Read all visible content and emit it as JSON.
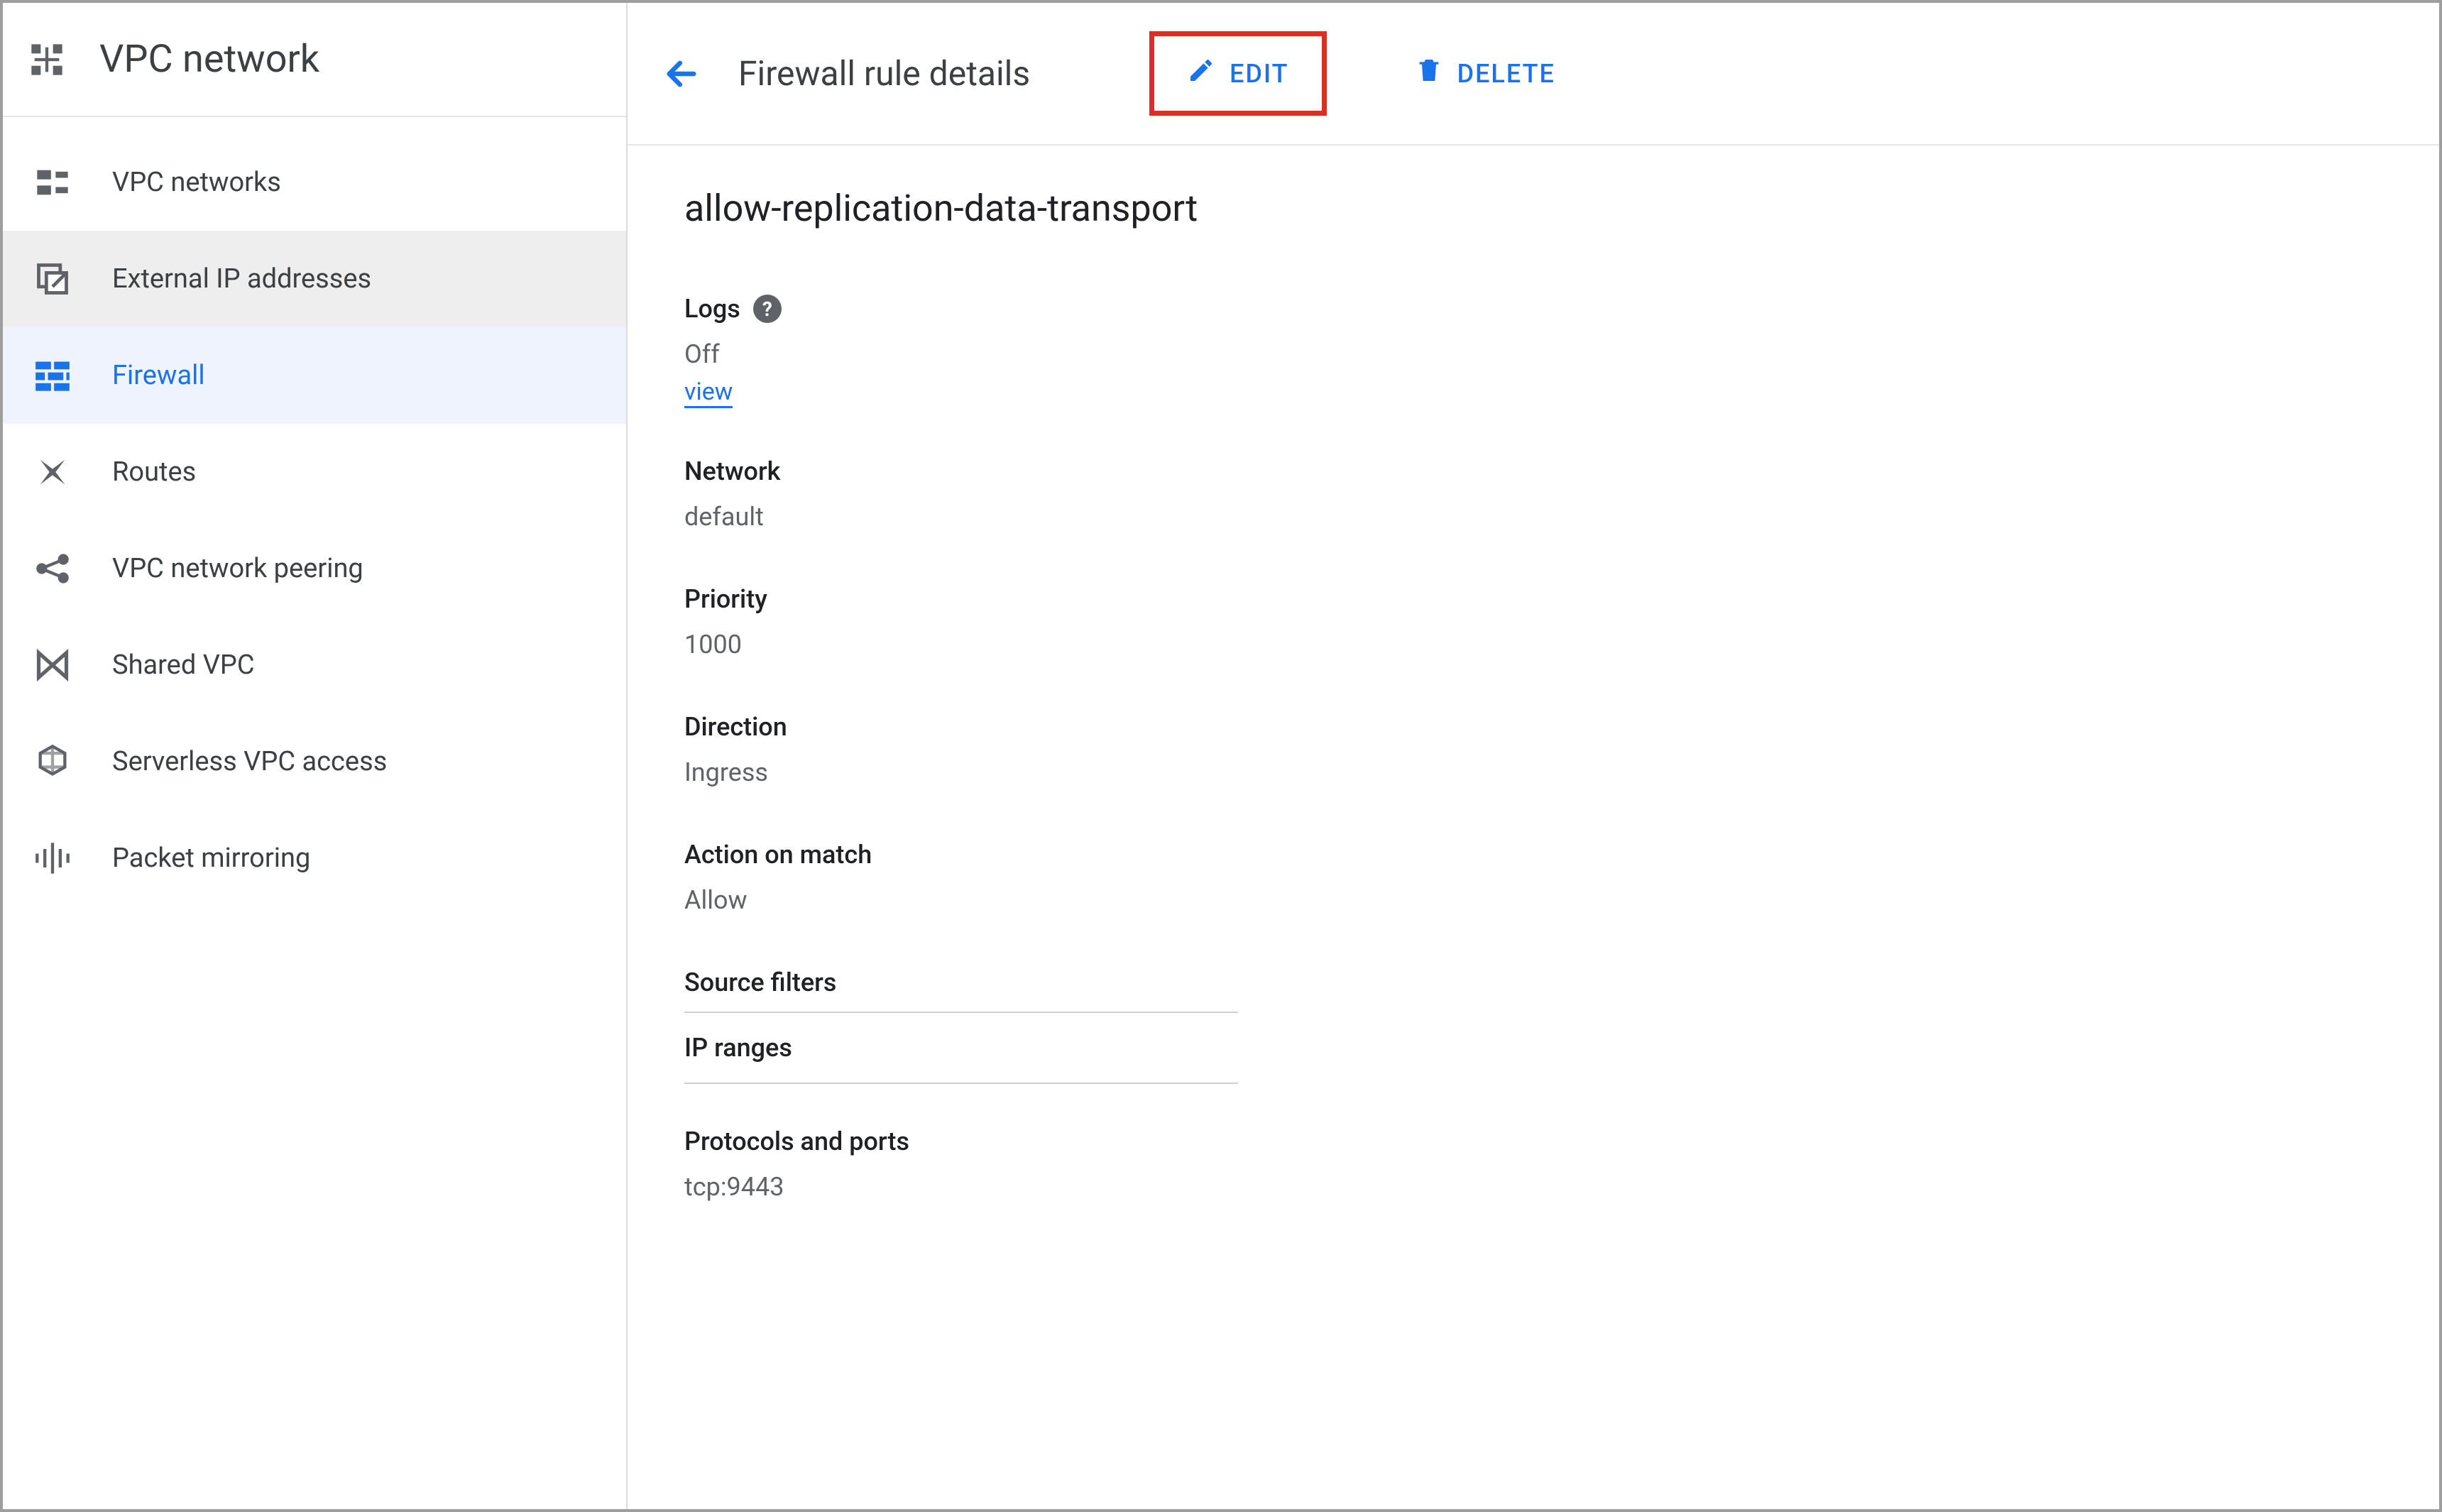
{
  "sidebar": {
    "title": "VPC network",
    "items": [
      {
        "label": "VPC networks"
      },
      {
        "label": "External IP addresses"
      },
      {
        "label": "Firewall"
      },
      {
        "label": "Routes"
      },
      {
        "label": "VPC network peering"
      },
      {
        "label": "Shared VPC"
      },
      {
        "label": "Serverless VPC access"
      },
      {
        "label": "Packet mirroring"
      }
    ]
  },
  "header": {
    "page_title": "Firewall rule details",
    "edit_label": "EDIT",
    "delete_label": "DELETE"
  },
  "rule": {
    "name": "allow-replication-data-transport",
    "logs": {
      "label": "Logs",
      "value": "Off",
      "view_link": "view"
    },
    "network": {
      "label": "Network",
      "value": "default"
    },
    "priority": {
      "label": "Priority",
      "value": "1000"
    },
    "direction": {
      "label": "Direction",
      "value": "Ingress"
    },
    "action": {
      "label": "Action on match",
      "value": "Allow"
    },
    "source_filters": {
      "label": "Source filters",
      "ip_ranges_label": "IP ranges"
    },
    "protocols": {
      "label": "Protocols and ports",
      "value": "tcp:9443"
    }
  },
  "colors": {
    "accent": "#1a73e8",
    "danger": "#d93025"
  }
}
